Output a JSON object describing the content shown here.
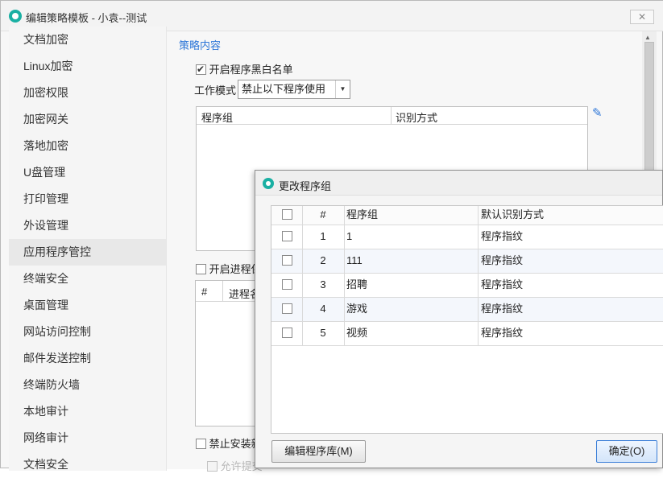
{
  "window": {
    "title": "编辑策略模板 - 小袁--测试"
  },
  "sidebar": {
    "items": [
      {
        "label": "文档加密"
      },
      {
        "label": "Linux加密"
      },
      {
        "label": "加密权限"
      },
      {
        "label": "加密网关"
      },
      {
        "label": "落地加密"
      },
      {
        "label": "U盘管理"
      },
      {
        "label": "打印管理"
      },
      {
        "label": "外设管理"
      },
      {
        "label": "应用程序管控",
        "active": true
      },
      {
        "label": "终端安全"
      },
      {
        "label": "桌面管理"
      },
      {
        "label": "网站访问控制"
      },
      {
        "label": "邮件发送控制"
      },
      {
        "label": "终端防火墙"
      },
      {
        "label": "本地审计"
      },
      {
        "label": "网络审计"
      },
      {
        "label": "文档安全"
      }
    ]
  },
  "content": {
    "section_title": "策略内容",
    "whitelist_label": "开启程序黑白名单",
    "whitelist_checked": true,
    "mode_label": "工作模式",
    "mode_value": "禁止以下程序使用",
    "program_table": {
      "col1": "程序组",
      "col2": "识别方式"
    },
    "process_protect_label": "开启进程保",
    "process_table": {
      "col1": "#",
      "col2": "进程名"
    },
    "forbid_install_label": "禁止安装新",
    "allow_submit_label": "允许提交"
  },
  "dialog": {
    "title": "更改程序组",
    "columns": {
      "num": "#",
      "group": "程序组",
      "method": "默认识别方式"
    },
    "rows": [
      {
        "num": "1",
        "group": "1",
        "method": "程序指纹"
      },
      {
        "num": "2",
        "group": "111",
        "method": "程序指纹"
      },
      {
        "num": "3",
        "group": "招聘",
        "method": "程序指纹"
      },
      {
        "num": "4",
        "group": "游戏",
        "method": "程序指纹"
      },
      {
        "num": "5",
        "group": "视频",
        "method": "程序指纹"
      }
    ],
    "edit_button": "编辑程序库(M)",
    "ok_button": "确定(O)"
  },
  "colors": {
    "accent": "#2f77d8",
    "logo": "#1ab0a3"
  }
}
